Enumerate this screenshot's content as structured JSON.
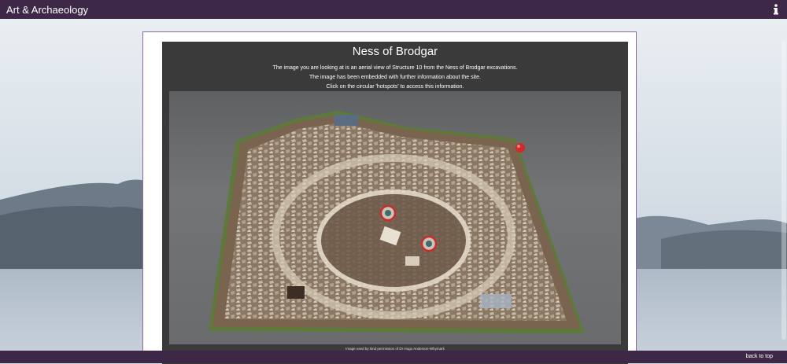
{
  "app": {
    "title": "Art & Archaeology"
  },
  "icons": {
    "info": "info-icon",
    "hotspot": "hotspot-marker-icon",
    "marker": "red-marker-icon"
  },
  "article": {
    "heading": "Ness of Brodgar",
    "description": [
      "The image you are looking at is an aerial view of Structure 10 from the Ness of Brodgar excavations.",
      "The image has been embedded with further information about the site.",
      "Click on the circular 'hotspots' to access this information."
    ],
    "credit": "Image used by kind permission of Dr Hugo Anderson-Whymark"
  },
  "footer": {
    "back_to_top": "back to top"
  },
  "colors": {
    "nav": "#3e2848",
    "panel": "#3a3a3a",
    "card_border": "#8a6aa0",
    "hotspot": "#cc2b2b"
  }
}
